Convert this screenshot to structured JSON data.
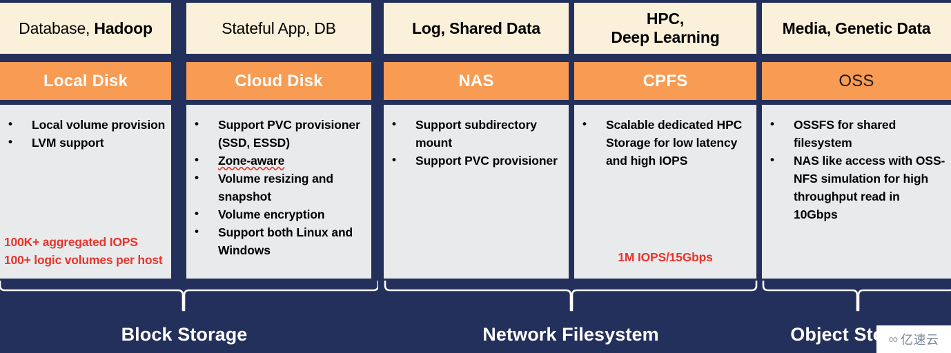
{
  "theme": {
    "background": "#24305c",
    "category_bg": "#fbf1da",
    "service_bg": "#f89b53",
    "feature_bg": "#e9eaec",
    "metric_color": "#e8352a",
    "label_color": "#ffffff"
  },
  "columns": [
    {
      "id": "local-disk",
      "category": "Database, ",
      "category_bold": "Hadoop",
      "service": "Local Disk",
      "service_style": "light",
      "features": [
        "Local volume provision",
        "LVM support"
      ],
      "metric": "100K+ aggregated IOPS\n100+ logic volumes per host",
      "metric_lines": [
        "100K+ aggregated IOPS",
        "100+ logic volumes per host"
      ],
      "metric_align": "left"
    },
    {
      "id": "cloud-disk",
      "category": "Stateful App, DB",
      "category_bold": "",
      "service": "Cloud Disk",
      "service_style": "light",
      "features": [
        "Support PVC provisioner (SSD, ESSD)",
        "Zone-aware",
        "Volume resizing and snapshot",
        "Volume encryption",
        "Support both Linux and Windows"
      ],
      "metric_lines": [],
      "metric_align": "left"
    },
    {
      "id": "nas",
      "category": "Log, Shared Data",
      "category_bold": "",
      "service": "NAS",
      "service_style": "light",
      "features": [
        "Support subdirectory mount",
        "Support PVC provisioner"
      ],
      "metric_lines": [],
      "metric_align": "left"
    },
    {
      "id": "cpfs",
      "category": "HPC,\nDeep Learning",
      "category_line1": "HPC,",
      "category_line2": "Deep Learning",
      "category_bold": "",
      "service": "CPFS",
      "service_style": "light",
      "features": [
        "Scalable dedicated HPC Storage for low latency and high IOPS"
      ],
      "metric_lines": [
        "1M IOPS/15Gbps"
      ],
      "metric_align": "center"
    },
    {
      "id": "oss",
      "category": "Media, Genetic Data",
      "category_bold": "",
      "service": "OSS",
      "service_style": "dark",
      "features": [
        "OSSFS for shared filesystem",
        "NAS like access with OSS-NFS simulation for high throughput read in 10Gbps"
      ],
      "metric_lines": [],
      "metric_align": "left"
    }
  ],
  "groups": [
    {
      "id": "block-storage",
      "label": "Block Storage"
    },
    {
      "id": "network-filesystem",
      "label": "Network Filesystem"
    },
    {
      "id": "object-storage",
      "label": "Object Storage"
    }
  ],
  "watermark": {
    "mark": "∞",
    "text": "亿速云"
  }
}
